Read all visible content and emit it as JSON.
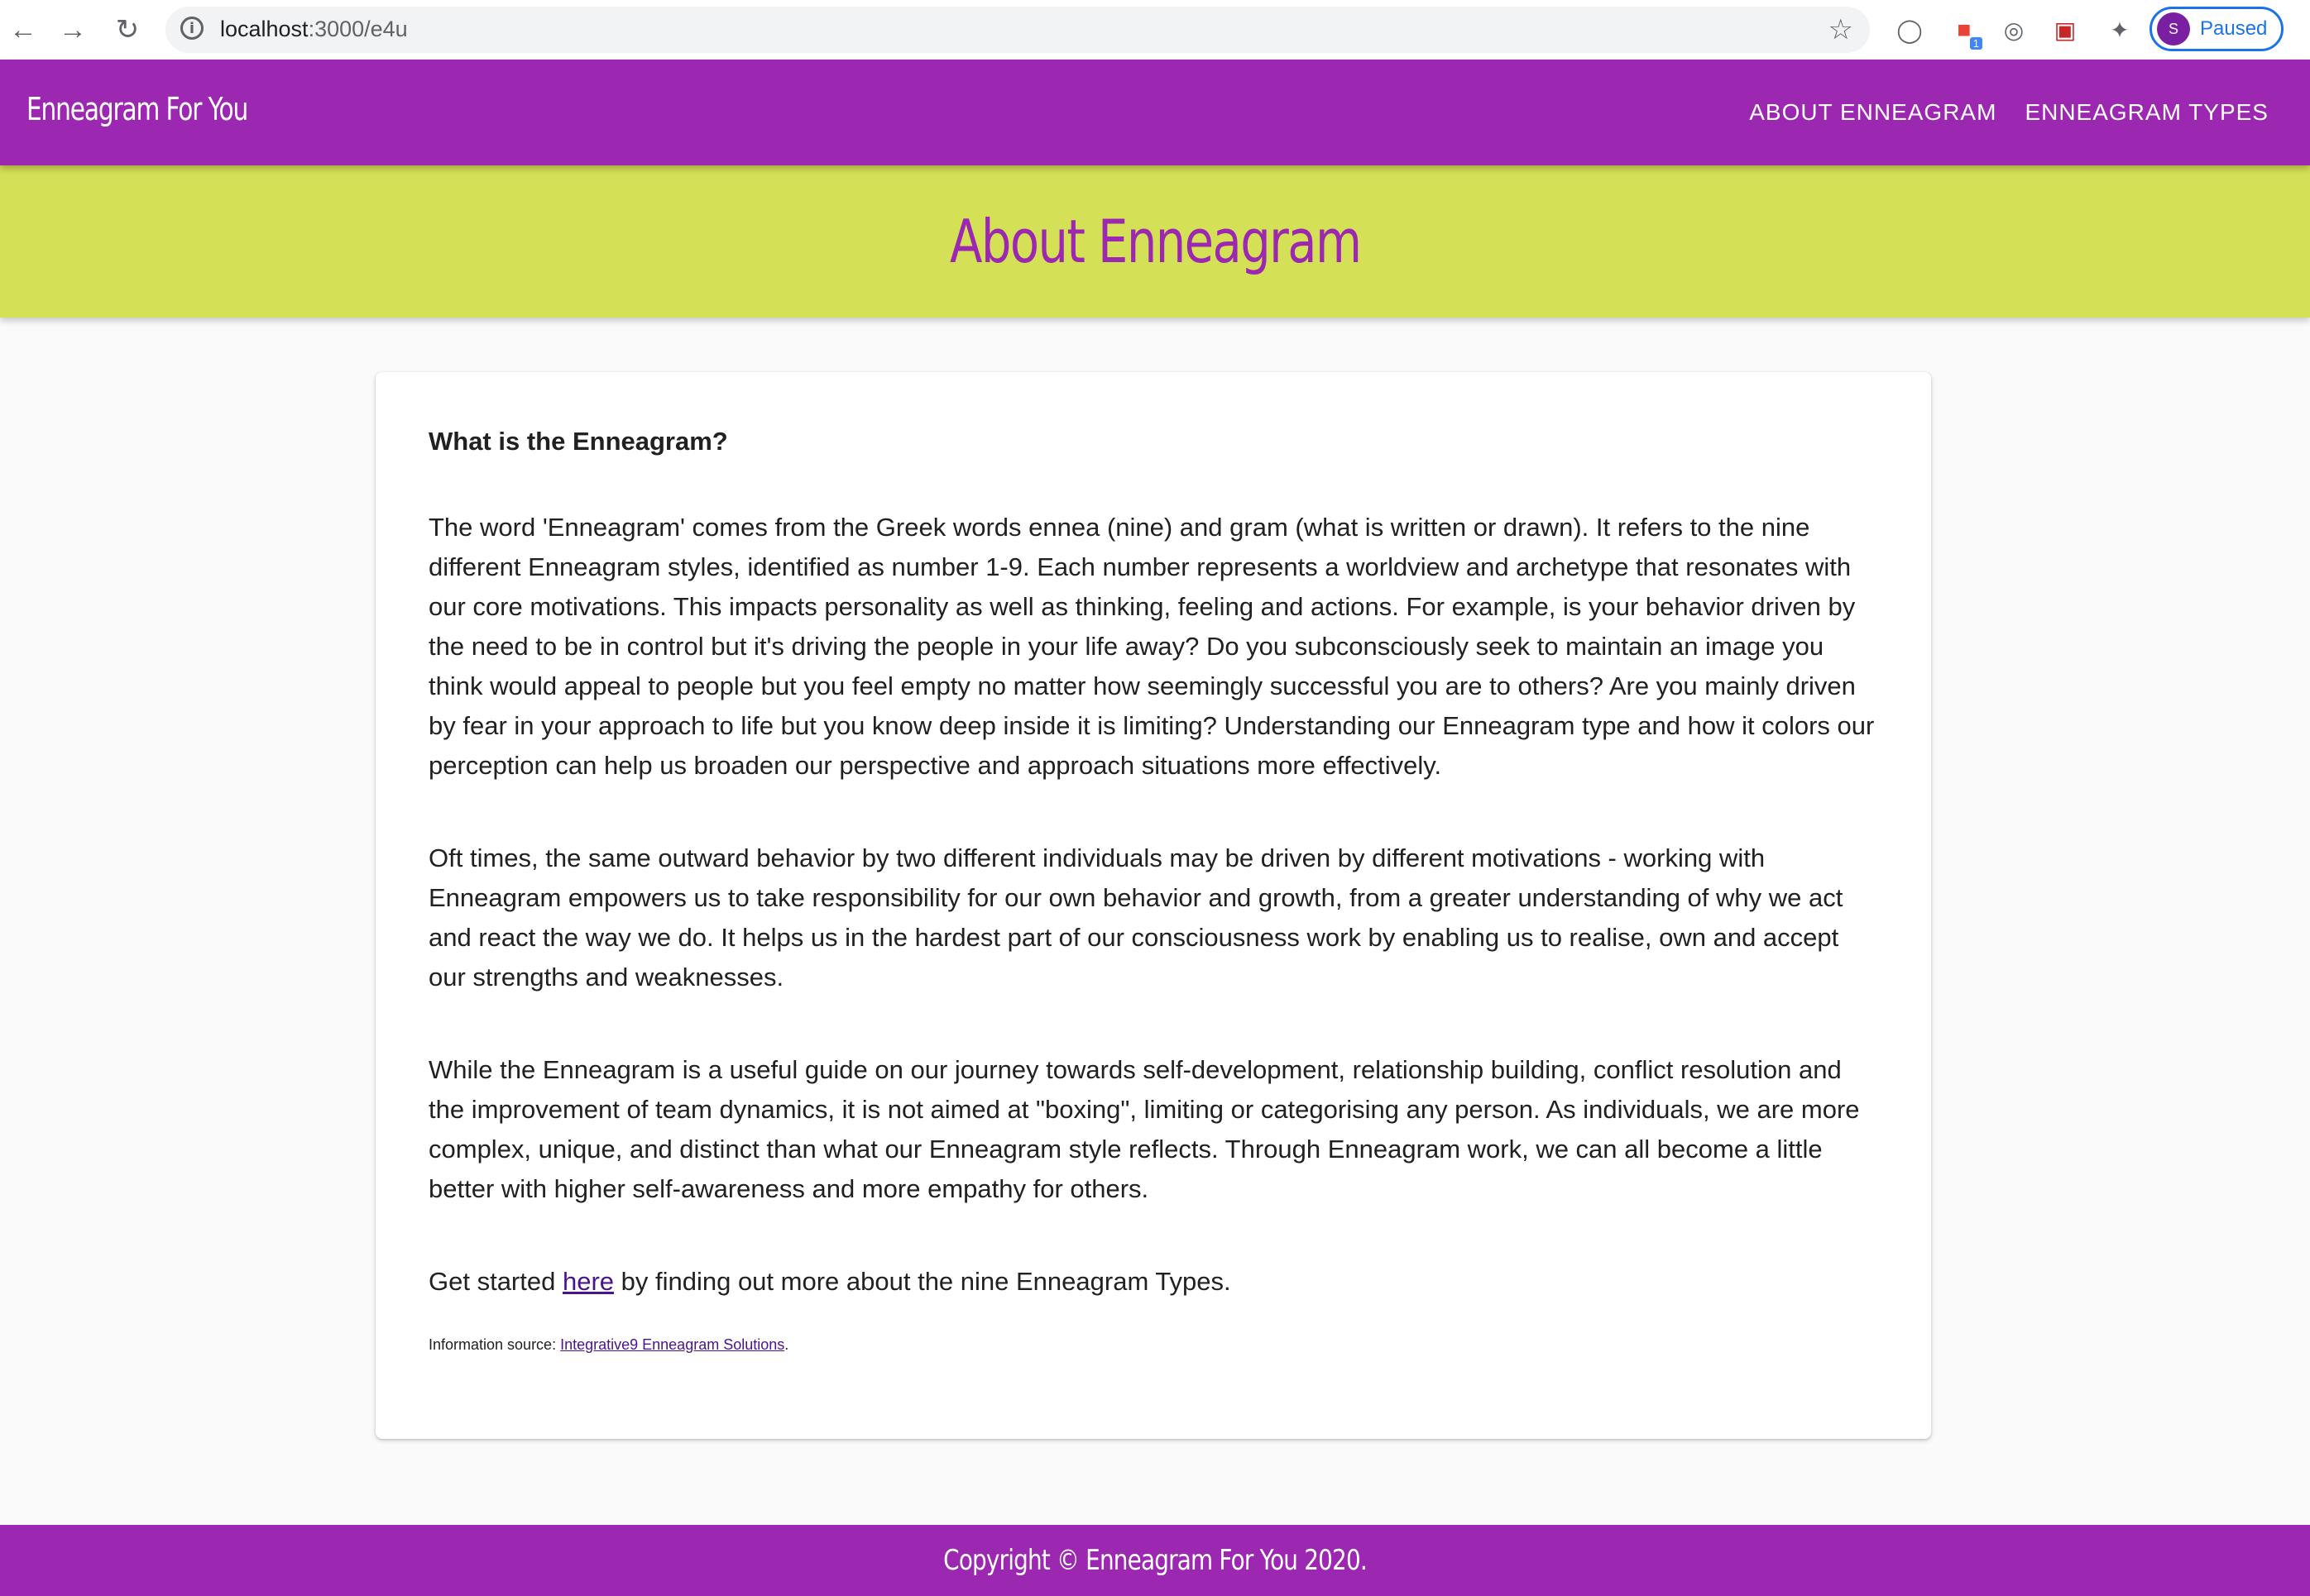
{
  "browser": {
    "url_host": "localhost",
    "url_path": ":3000/e4u",
    "profile_initial": "S",
    "profile_status": "Paused",
    "extension_badge": "1"
  },
  "header": {
    "brand": "Enneagram For You",
    "nav": [
      "ABOUT ENNEAGRAM",
      "ENNEAGRAM TYPES"
    ]
  },
  "hero": {
    "title": "About Enneagram"
  },
  "content": {
    "heading": "What is the Enneagram?",
    "paragraphs": [
      "The word 'Enneagram' comes from the Greek words ennea (nine) and gram (what is written or drawn). It refers to the nine different Enneagram styles, identified as number 1-9. Each number represents a worldview and archetype that resonates with our core motivations. This impacts personality as well as thinking, feeling and actions. For example, is your behavior driven by the need to be in control but it's driving the people in your life away? Do you subconsciously seek to maintain an image you think would appeal to people but you feel empty no matter how seemingly successful you are to others? Are you mainly driven by fear in your approach to life but you know deep inside it is limiting? Understanding our Enneagram type and how it colors our perception can help us broaden our perspective and approach situations more effectively.",
      "Oft times, the same outward behavior by two different individuals may be driven by different motivations - working with Enneagram empowers us to take responsibility for our own behavior and growth, from a greater understanding of why we act and react the way we do. It helps us in the hardest part of our consciousness work by enabling us to realise, own and accept our strengths and weaknesses.",
      "While the Enneagram is a useful guide on our journey towards self-development, relationship building, conflict resolution and the improvement of team dynamics, it is not aimed at \"boxing\", limiting or categorising any person. As individuals, we are more complex, unique, and distinct than what our Enneagram style reflects. Through Enneagram work, we can all become a little better with higher self-awareness and more empathy for others."
    ],
    "cta_prefix": "Get started ",
    "cta_link": "here",
    "cta_suffix": " by finding out more about the nine Enneagram Types.",
    "source_prefix": "Information source: ",
    "source_link": "Integrative9 Enneagram Solutions",
    "source_suffix": "."
  },
  "footer": {
    "text": "Copyright © Enneagram For You 2020."
  },
  "colors": {
    "primary": "#9c27b0",
    "accent": "#d4e157",
    "link": "#4a148c"
  }
}
